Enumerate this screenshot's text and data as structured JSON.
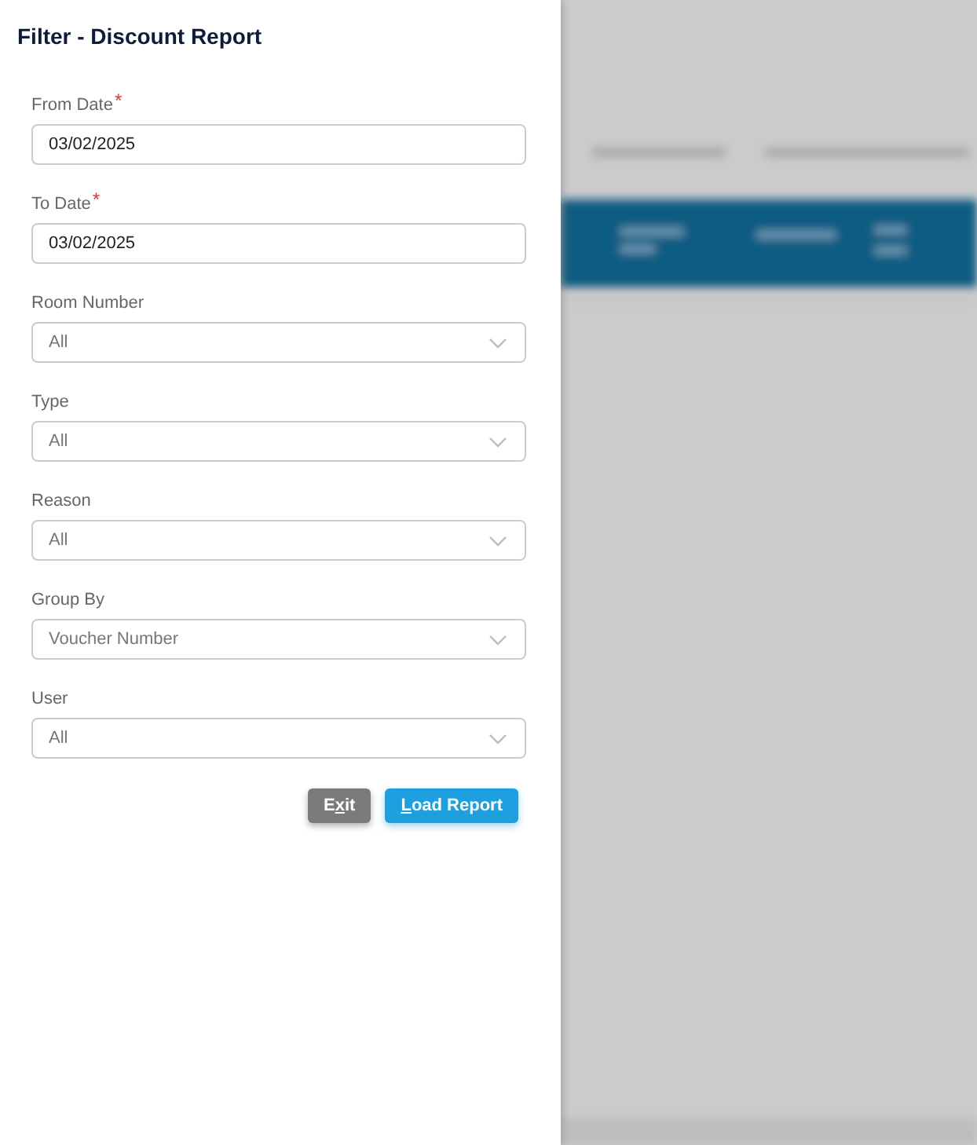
{
  "panel": {
    "title": "Filter - Discount Report"
  },
  "fields": [
    {
      "kind": "date",
      "label": "From Date",
      "required": true,
      "value": "03/02/2025"
    },
    {
      "kind": "date",
      "label": "To Date",
      "required": true,
      "value": "03/02/2025"
    },
    {
      "kind": "select",
      "label": "Room Number",
      "required": false,
      "value": "All"
    },
    {
      "kind": "select",
      "label": "Type",
      "required": false,
      "value": "All"
    },
    {
      "kind": "select",
      "label": "Reason",
      "required": false,
      "value": "All"
    },
    {
      "kind": "select",
      "label": "Group By",
      "required": false,
      "value": "Voucher Number"
    },
    {
      "kind": "select",
      "label": "User",
      "required": false,
      "value": "All"
    }
  ],
  "buttons": [
    {
      "kind": "secondary",
      "before": "E",
      "key": "x",
      "after": "it"
    },
    {
      "kind": "primary",
      "key": "L",
      "after": "oad Report"
    }
  ],
  "required_mark": "*"
}
